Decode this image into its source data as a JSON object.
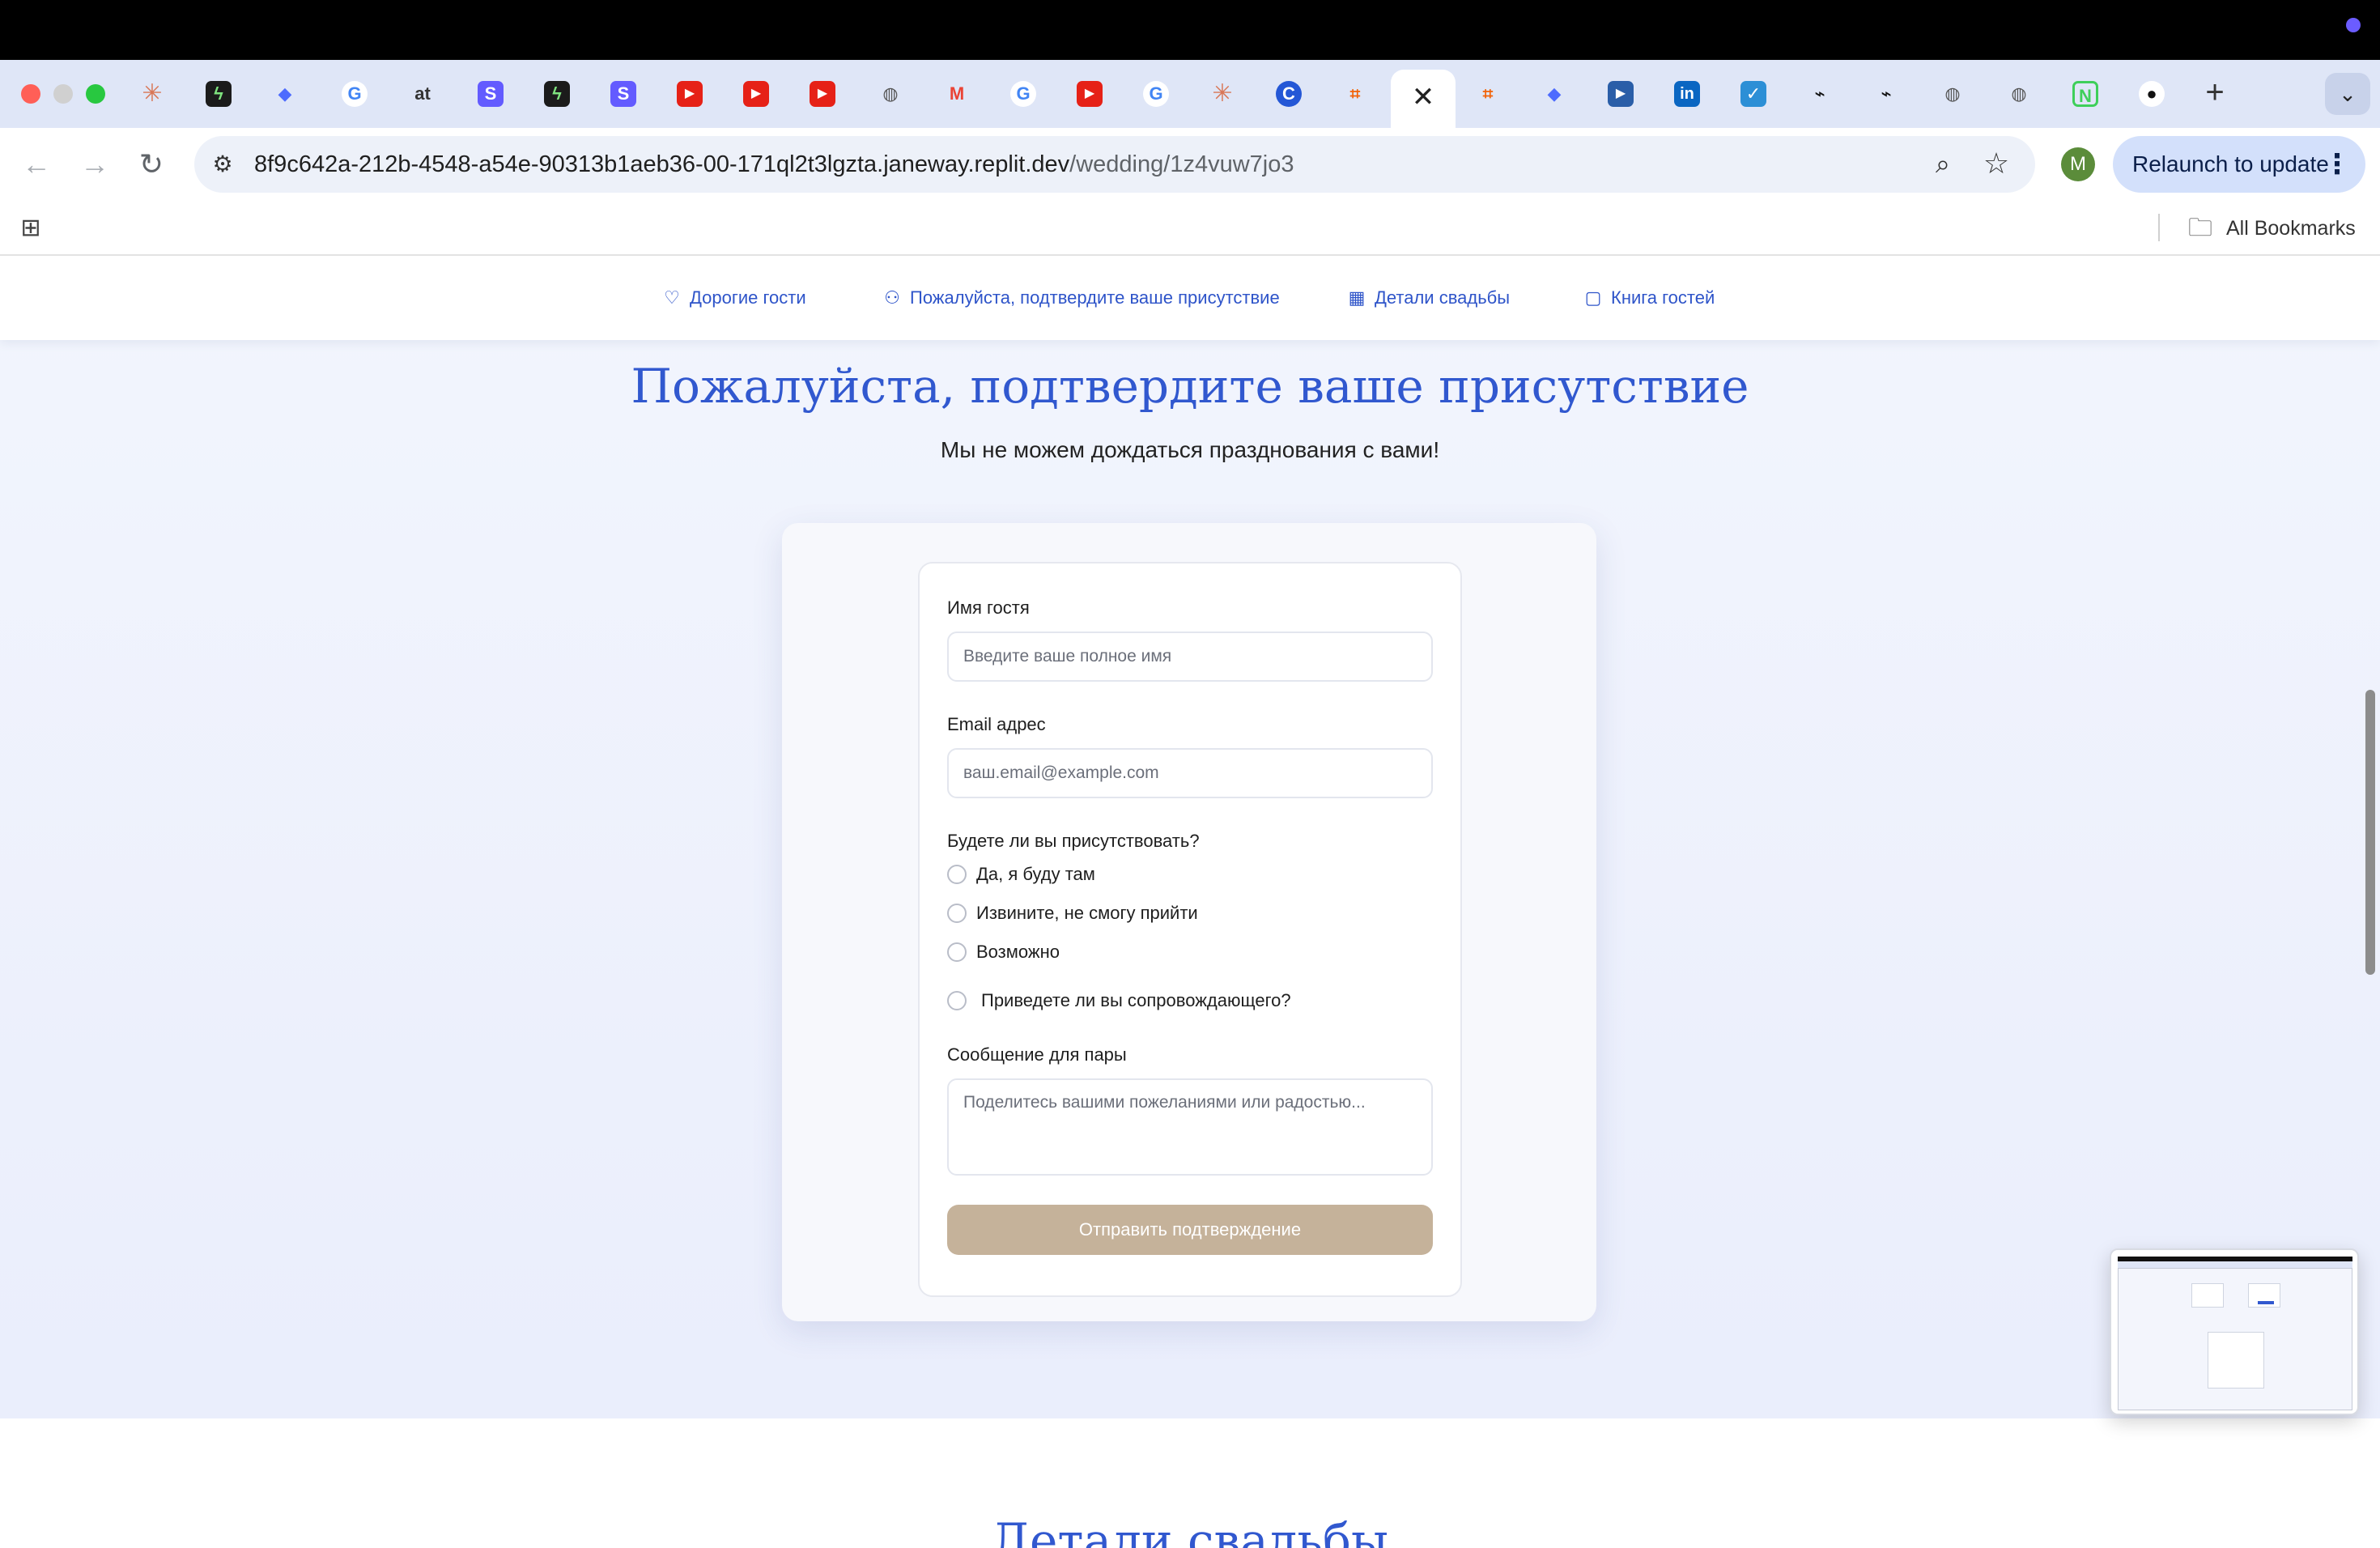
{
  "browser": {
    "url_host": "8f9c642a-212b-4548-a54e-90313b1aeb36-00-171ql2t3lgzta.janeway.replit.dev",
    "url_path": "/wedding/1z4vuw7jo3",
    "relaunch_label": "Relaunch to update",
    "profile_initial": "M",
    "all_bookmarks_label": "All Bookmarks",
    "active_tab_close": "✕",
    "new_tab": "+",
    "tab_icons": [
      "claude-icon",
      "replit-icon",
      "deepseek-icon",
      "google-icon",
      "at-icon",
      "stripe-icon",
      "replit-icon",
      "stripe-icon",
      "youtube-icon",
      "youtube-icon",
      "youtube-icon",
      "globe-icon",
      "gmail-icon",
      "google-icon",
      "youtube-icon",
      "google-icon",
      "claude-icon",
      "c-icon",
      "replit-icon",
      "replit-icon",
      "deepseek-icon",
      "video-icon",
      "linkedin-icon",
      "tasks-icon",
      "shortcut-icon",
      "shortcut-icon",
      "globe-icon",
      "globe-icon",
      "notion-icon",
      "github-icon"
    ]
  },
  "site_nav": {
    "items": [
      {
        "label": "Дорогие гости",
        "icon": "heart-icon"
      },
      {
        "label": "Пожалуйста, подтвердите ваше присутствие",
        "icon": "users-icon"
      },
      {
        "label": "Детали свадьбы",
        "icon": "calendar-icon"
      },
      {
        "label": "Книга гостей",
        "icon": "message-icon"
      }
    ]
  },
  "rsvp": {
    "title": "Пожалуйста, подтвердите ваше присутствие",
    "subtitle": "Мы не можем дождаться празднования с вами!",
    "name_label": "Имя гостя",
    "name_placeholder": "Введите ваше полное имя",
    "email_label": "Email адрес",
    "email_placeholder": "ваш.email@example.com",
    "attendance_question": "Будете ли вы присутствовать?",
    "options": [
      "Да, я буду там",
      "Извините, не смогу прийти",
      "Возможно"
    ],
    "plus_one_label": "Приведете ли вы сопровождающего?",
    "message_label": "Сообщение для пары",
    "message_placeholder": "Поделитесь вашими пожеланиями или радостью...",
    "submit_label": "Отправить подтверждение"
  },
  "next_section": {
    "title": "Детали свадьбы"
  },
  "colors": {
    "accent": "#3158cf",
    "submit": "#c5b29a",
    "page_bg": "#eef1fc"
  }
}
